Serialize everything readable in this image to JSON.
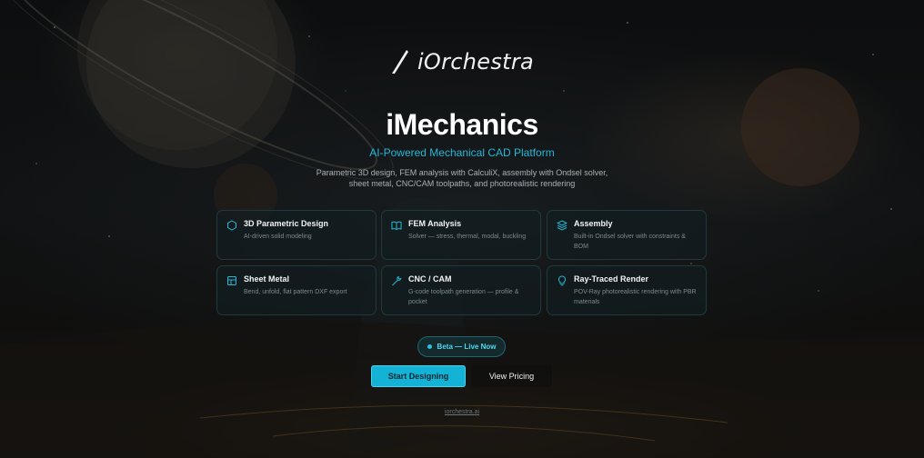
{
  "brand": {
    "name": "iOrchestra",
    "logo_icon": "slash-pen-icon"
  },
  "hero": {
    "title": "iMechanics",
    "subtitle": "AI-Powered Mechanical CAD Platform",
    "description": "Parametric 3D design, FEM analysis with CalculiX, assembly with Ondsel solver, sheet metal, CNC/CAM toolpaths, and photorealistic rendering"
  },
  "features": [
    {
      "icon": "hexagon-icon",
      "title": "3D Parametric Design",
      "text": "AI-driven solid modeling"
    },
    {
      "icon": "book-icon",
      "title": "FEM Analysis",
      "text": "Solver — stress, thermal, modal, buckling"
    },
    {
      "icon": "layers-icon",
      "title": "Assembly",
      "text": "Built-in Ondsel solver with constraints & BOM"
    },
    {
      "icon": "grid-icon",
      "title": "Sheet Metal",
      "text": "Bend, unfold, flat pattern DXF export"
    },
    {
      "icon": "wrench-icon",
      "title": "CNC / CAM",
      "text": "G-code toolpath generation — profile & pocket"
    },
    {
      "icon": "lightbulb-icon",
      "title": "Ray-Traced Render",
      "text": "POV-Ray photorealistic rendering with PBR materials"
    }
  ],
  "badge": {
    "label": "Beta — Live Now"
  },
  "actions": {
    "primary_label": "Start Designing",
    "secondary_label": "View Pricing"
  },
  "footer": {
    "link": "iorchestra.ai"
  },
  "colors": {
    "accent": "#14b3d5",
    "background": "#0b0c0d",
    "card_border": "#1f3a3f"
  }
}
